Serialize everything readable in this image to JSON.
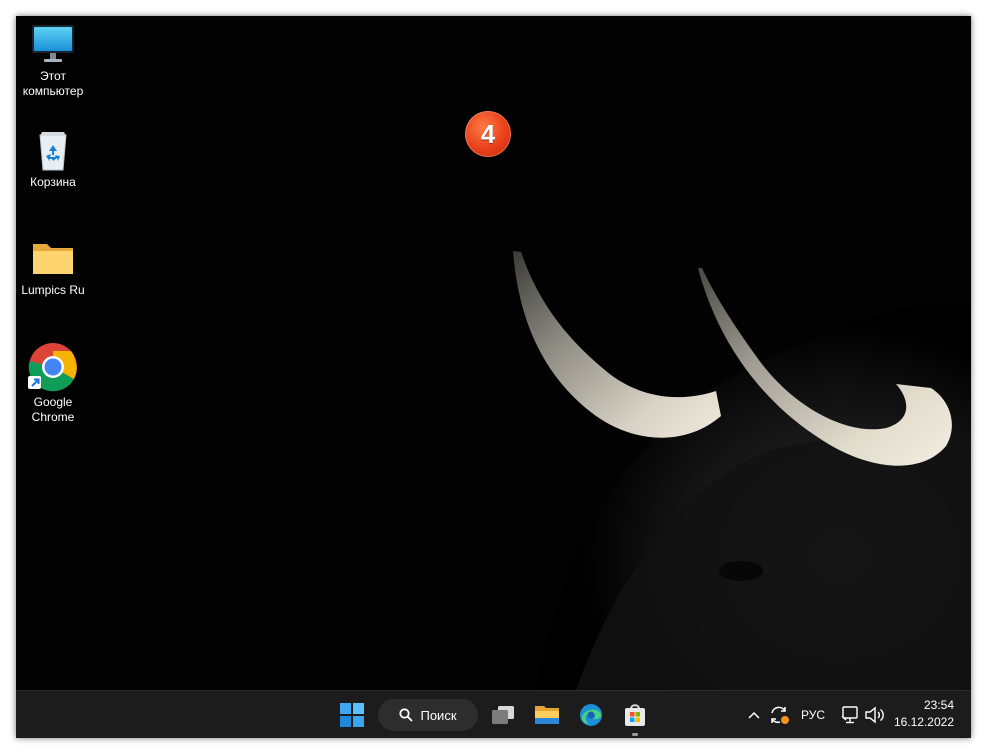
{
  "desktop": {
    "icons": [
      {
        "label": "Этот компьютер",
        "icon": "monitor-icon"
      },
      {
        "label": "Корзина",
        "icon": "recycle-bin-icon"
      },
      {
        "label": "Lumpics Ru",
        "icon": "folder-icon"
      },
      {
        "label": "Google Chrome",
        "icon": "chrome-icon"
      }
    ],
    "step_badge": "4"
  },
  "taskbar": {
    "start": {
      "icon": "windows-start-icon"
    },
    "search": {
      "label": "Поиск",
      "icon": "search-icon"
    },
    "apps": [
      {
        "name": "task-view",
        "icon": "task-view-icon"
      },
      {
        "name": "file-explorer",
        "icon": "folder-icon"
      },
      {
        "name": "edge",
        "icon": "edge-icon"
      },
      {
        "name": "store",
        "icon": "store-icon"
      }
    ],
    "tray": {
      "chevron_icon": "chevron-up-icon",
      "sync_icon": "sync-icon",
      "language": "РУС",
      "network_icon": "network-icon",
      "volume_icon": "volume-icon"
    },
    "clock": {
      "time": "23:54",
      "date": "16.12.2022"
    }
  },
  "colors": {
    "taskbar_bg": "#1c1c1c",
    "badge": "#e8401a",
    "desktop_bg": "#000000"
  }
}
